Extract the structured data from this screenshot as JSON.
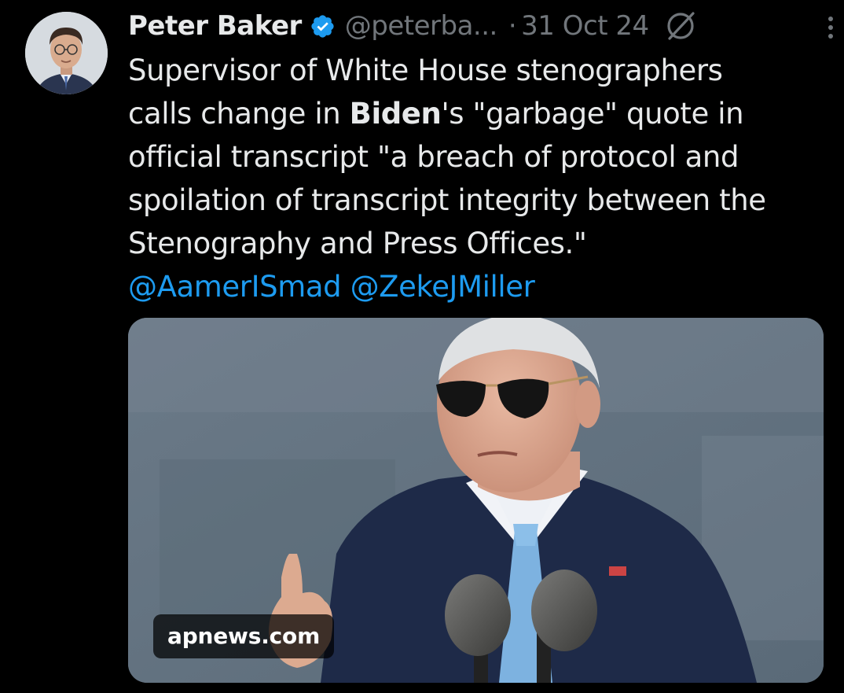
{
  "tweet": {
    "author": {
      "display_name": "Peter Baker",
      "handle": "@peterba...",
      "verified": true,
      "avatar_icon": "avatar-photo"
    },
    "separator": "·",
    "timestamp": "31 Oct 24",
    "icons": {
      "verified": "verified-badge-icon",
      "grok": "grok-icon",
      "more": "more-vertical-icon"
    },
    "text": {
      "line1": "Supervisor of White House stenographers",
      "line2_pre": "calls change in ",
      "line2_bold": "Biden",
      "line2_post": "'s \"garbage\" quote in",
      "line3": "official transcript \"a breach of protocol and",
      "line4": "spoilation of transcript integrity between the",
      "line5": "Stenography and Press Offices.\"",
      "mention1": "@AamerISmad",
      "mention2": "@ZekeJMiller"
    },
    "media": {
      "source_domain": "apnews.com"
    }
  },
  "colors": {
    "background": "#000000",
    "text_primary": "#e7e9ea",
    "text_secondary": "#71767b",
    "link": "#1d9bf0",
    "verified": "#1d9bf0"
  }
}
